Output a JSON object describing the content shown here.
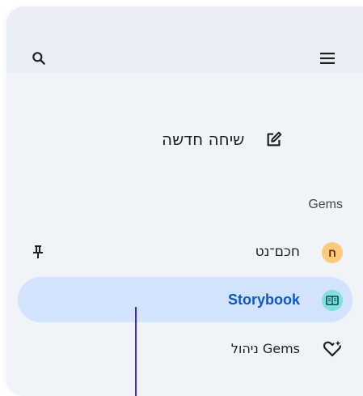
{
  "header": {
    "search_icon": "search-icon",
    "menu_icon": "hamburger-menu-icon"
  },
  "new_chat": {
    "label": "שיחה חדשה",
    "icon": "edit-pencil-icon"
  },
  "gems": {
    "title": "Gems",
    "items": [
      {
        "label": "חכם־נט",
        "avatar": "ח",
        "avatar_color": "#ffc97a",
        "pinned": true,
        "active": false
      },
      {
        "label": "Storybook",
        "icon": "book-icon",
        "avatar_color": "#7fe0dd",
        "active": true
      },
      {
        "label": "ניהול Gems",
        "icon": "heart-sparkle-icon",
        "active": false
      }
    ]
  },
  "colors": {
    "panel_bg": "#e9eef6",
    "active_row_bg": "#d3e3fd",
    "active_text": "#0b57d0"
  }
}
